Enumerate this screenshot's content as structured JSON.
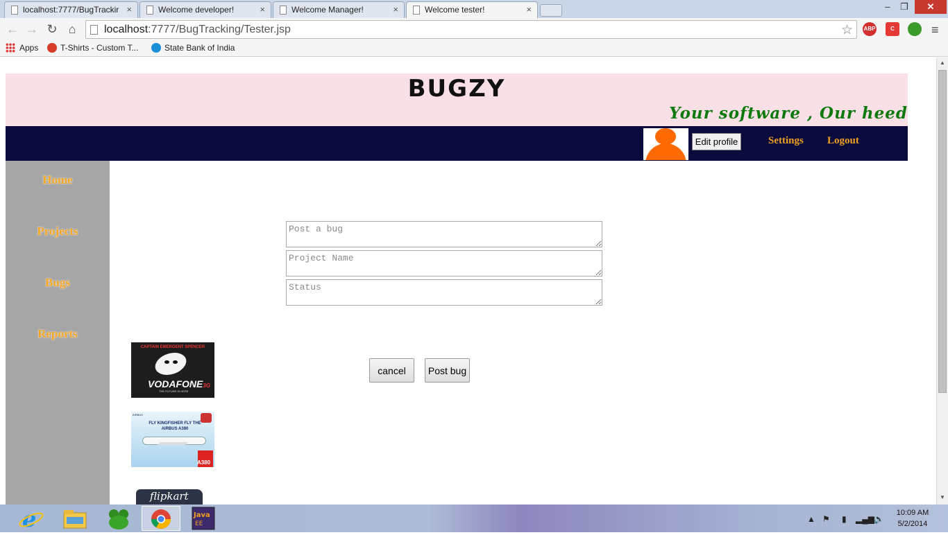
{
  "browser": {
    "tabs": [
      {
        "title": "localhost:7777/BugTrackir",
        "active": false
      },
      {
        "title": "Welcome developer!",
        "active": false
      },
      {
        "title": "Welcome Manager!",
        "active": false
      },
      {
        "title": "Welcome tester!",
        "active": true
      }
    ],
    "close_glyph": "×",
    "window_controls": {
      "minimize": "–",
      "restore": "❐",
      "close": "✕"
    },
    "url_host": "localhost",
    "url_path": ":7777/BugTracking/Tester.jsp",
    "extensions": [
      {
        "name": "abp-icon",
        "label": "ABP",
        "color": "#d32f2f"
      },
      {
        "name": "c-icon",
        "label": "C",
        "color": "#e53935"
      },
      {
        "name": "frog-icon",
        "label": "",
        "color": "#3a9a2a"
      }
    ],
    "bookmarks": [
      {
        "label": "Apps"
      },
      {
        "label": "T-Shirts - Custom T..."
      },
      {
        "label": "State Bank of India"
      }
    ]
  },
  "page": {
    "brand": "BUGZY",
    "tagline": "Your software , Our heed",
    "nav": {
      "edit_profile": "Edit profile",
      "settings": "Settings",
      "logout": "Logout"
    },
    "sidebar": [
      {
        "label": "Home"
      },
      {
        "label": "Projects"
      },
      {
        "label": "Bugs"
      },
      {
        "label": "Reports"
      }
    ],
    "form": {
      "bug_placeholder": "Post a bug",
      "project_placeholder": "Project Name",
      "status_placeholder": "Status",
      "cancel_label": "cancel",
      "post_label": "Post bug"
    },
    "ads": {
      "ad1_top": "CAPTAIN EMERGENT SPENCER",
      "ad1_brand": "VODAFONE",
      "ad1_3g": "3G",
      "ad1_sub": "THE FUTURE IS HERE",
      "ad2_brandtop": "AIRBUS",
      "ad2_text": "FLY KINGFISHER FLY THE AIRBUS A380",
      "ad2_a380": "A380",
      "ad3_text": "flipkart"
    }
  },
  "taskbar": {
    "time": "10:09 AM",
    "date": "5/2/2014",
    "items": [
      {
        "name": "ie-icon"
      },
      {
        "name": "explorer-icon"
      },
      {
        "name": "frog-icon"
      },
      {
        "name": "chrome-icon",
        "active": true
      },
      {
        "name": "java-ee-ide-icon",
        "label": "Java EE IDE"
      }
    ]
  }
}
